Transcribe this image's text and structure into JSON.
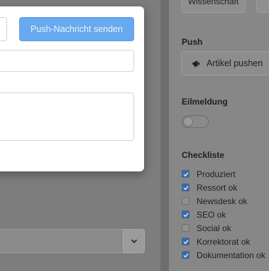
{
  "modal": {
    "push_button_label": "Push-Nachricht senden"
  },
  "sidebar": {
    "top_button_label": "Wissenschaft",
    "push_section_label": "Push",
    "push_article_button_label": "Artikel pushen",
    "breaking_label": "Eilmeldung",
    "breaking_enabled": false,
    "checklist_label": "Checkliste",
    "checklist": [
      {
        "label": "Produziert",
        "checked": true
      },
      {
        "label": "Ressort ok",
        "checked": true
      },
      {
        "label": "Newsdesk ok",
        "checked": false
      },
      {
        "label": "SEO ok",
        "checked": true
      },
      {
        "label": "Social ok",
        "checked": false
      },
      {
        "label": "Korrektorat ok",
        "checked": true
      },
      {
        "label": "Dokumentation ok",
        "checked": true
      }
    ]
  },
  "colors": {
    "primary": "#68a9ef",
    "checkbox_on": "#3d6aa0"
  }
}
